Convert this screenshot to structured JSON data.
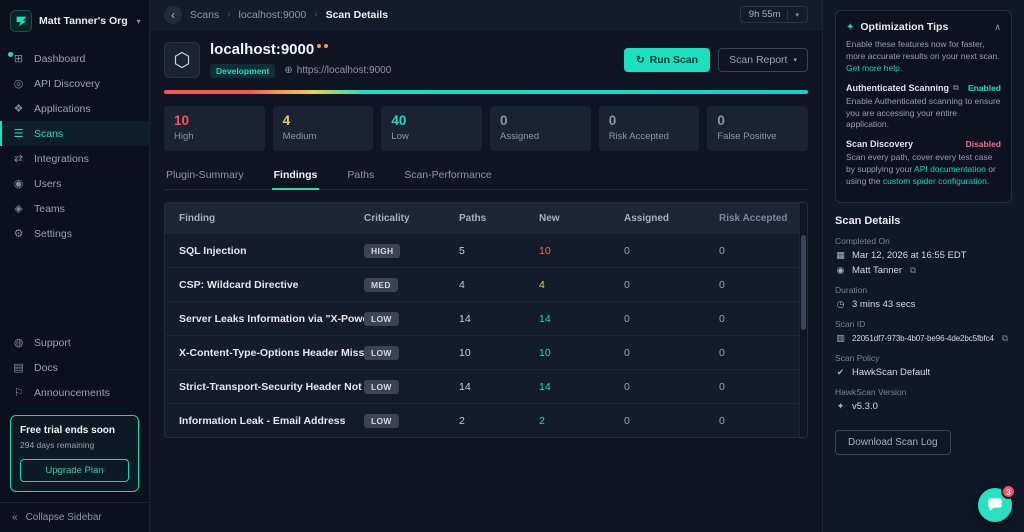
{
  "icons": {
    "caret_down": "▾",
    "chevron_left": "‹",
    "crumb_sep": "›",
    "chevron_up": "∧",
    "external": "⧉",
    "copy": "⧉",
    "globe": "⊕",
    "refresh": "↻",
    "collapse": "«",
    "bulb": "✦",
    "calendar": "▦",
    "user": "◉",
    "clock": "◷",
    "id": "▥",
    "policy": "✔",
    "version": "✦"
  },
  "sidebar": {
    "org": "Matt Tanner's Org",
    "nav": [
      {
        "label": "Dashboard",
        "icon": "⊞"
      },
      {
        "label": "API Discovery",
        "icon": "◎"
      },
      {
        "label": "Applications",
        "icon": "❖"
      },
      {
        "label": "Scans",
        "icon": "☰"
      },
      {
        "label": "Integrations",
        "icon": "⇄"
      },
      {
        "label": "Users",
        "icon": "◉"
      },
      {
        "label": "Teams",
        "icon": "◈"
      },
      {
        "label": "Settings",
        "icon": "⚙"
      }
    ],
    "secondary": [
      {
        "label": "Support",
        "icon": "◍"
      },
      {
        "label": "Docs",
        "icon": "▤"
      },
      {
        "label": "Announcements",
        "icon": "⚐"
      }
    ],
    "trial": {
      "title": "Free trial ends soon",
      "remaining": "294 days remaining",
      "upgrade": "Upgrade Plan"
    },
    "collapse": "Collapse Sidebar"
  },
  "breadcrumb": {
    "scans": "Scans",
    "app": "localhost:9000",
    "page": "Scan Details",
    "timer": "9h 55m"
  },
  "header": {
    "title": "localhost:9000",
    "badge": "Development",
    "url": "https://localhost:9000",
    "run_scan": "Run Scan",
    "scan_report": "Scan Report"
  },
  "stats": [
    {
      "value": "10",
      "label": "High",
      "tone": "red"
    },
    {
      "value": "4",
      "label": "Medium",
      "tone": "yellow"
    },
    {
      "value": "40",
      "label": "Low",
      "tone": "teal"
    },
    {
      "value": "0",
      "label": "Assigned",
      "tone": "muted"
    },
    {
      "value": "0",
      "label": "Risk Accepted",
      "tone": "muted"
    },
    {
      "value": "0",
      "label": "False Positive",
      "tone": "muted"
    }
  ],
  "tabs": [
    {
      "label": "Plugin-Summary"
    },
    {
      "label": "Findings"
    },
    {
      "label": "Paths"
    },
    {
      "label": "Scan-Performance"
    }
  ],
  "table": {
    "columns": [
      "Finding",
      "Criticality",
      "Paths",
      "New",
      "Assigned",
      "Risk Accepted"
    ],
    "rows": [
      {
        "finding": "SQL Injection",
        "criticality": "HIGH",
        "paths": "5",
        "new": "10",
        "assigned": "0",
        "risk": "0",
        "tone": "red"
      },
      {
        "finding": "CSP: Wildcard Directive",
        "criticality": "MED",
        "paths": "4",
        "new": "4",
        "assigned": "0",
        "risk": "0",
        "tone": "yellow"
      },
      {
        "finding": "Server Leaks Information via \"X-Powe...",
        "criticality": "LOW",
        "paths": "14",
        "new": "14",
        "assigned": "0",
        "risk": "0",
        "tone": "teal"
      },
      {
        "finding": "X-Content-Type-Options Header Miss...",
        "criticality": "LOW",
        "paths": "10",
        "new": "10",
        "assigned": "0",
        "risk": "0",
        "tone": "teal"
      },
      {
        "finding": "Strict-Transport-Security Header Not ...",
        "criticality": "LOW",
        "paths": "14",
        "new": "14",
        "assigned": "0",
        "risk": "0",
        "tone": "teal"
      },
      {
        "finding": "Information Leak - Email Address",
        "criticality": "LOW",
        "paths": "2",
        "new": "2",
        "assigned": "0",
        "risk": "0",
        "tone": "teal"
      }
    ]
  },
  "tips": {
    "title": "Optimization Tips",
    "intro": "Enable these features now for faster, more accurate results on your next scan.",
    "help_link": "Get more help.",
    "auth": {
      "name": "Authenticated Scanning",
      "status": "Enabled",
      "desc": "Enable Authenticated scanning to ensure you are accessing your entire application."
    },
    "discovery": {
      "name": "Scan Discovery",
      "status": "Disabled",
      "desc_parts": [
        "Scan every path, cover every test case by supplying your ",
        "API documentation",
        " or using the ",
        "custom spider configuration",
        "."
      ]
    }
  },
  "details": {
    "title": "Scan Details",
    "completed_label": "Completed On",
    "completed_date": "Mar 12, 2026 at 16:55 EDT",
    "completed_by": "Matt Tanner",
    "duration_label": "Duration",
    "duration": "3 mins 43 secs",
    "scan_id_label": "Scan ID",
    "scan_id": "22051df7-973b-4b07-be96-4de2bc5fbfc4",
    "policy_label": "Scan Policy",
    "policy": "HawkScan Default",
    "version_label": "HawkScan Version",
    "version": "v5.3.0",
    "download": "Download Scan Log"
  },
  "chat": {
    "badge": "3"
  }
}
